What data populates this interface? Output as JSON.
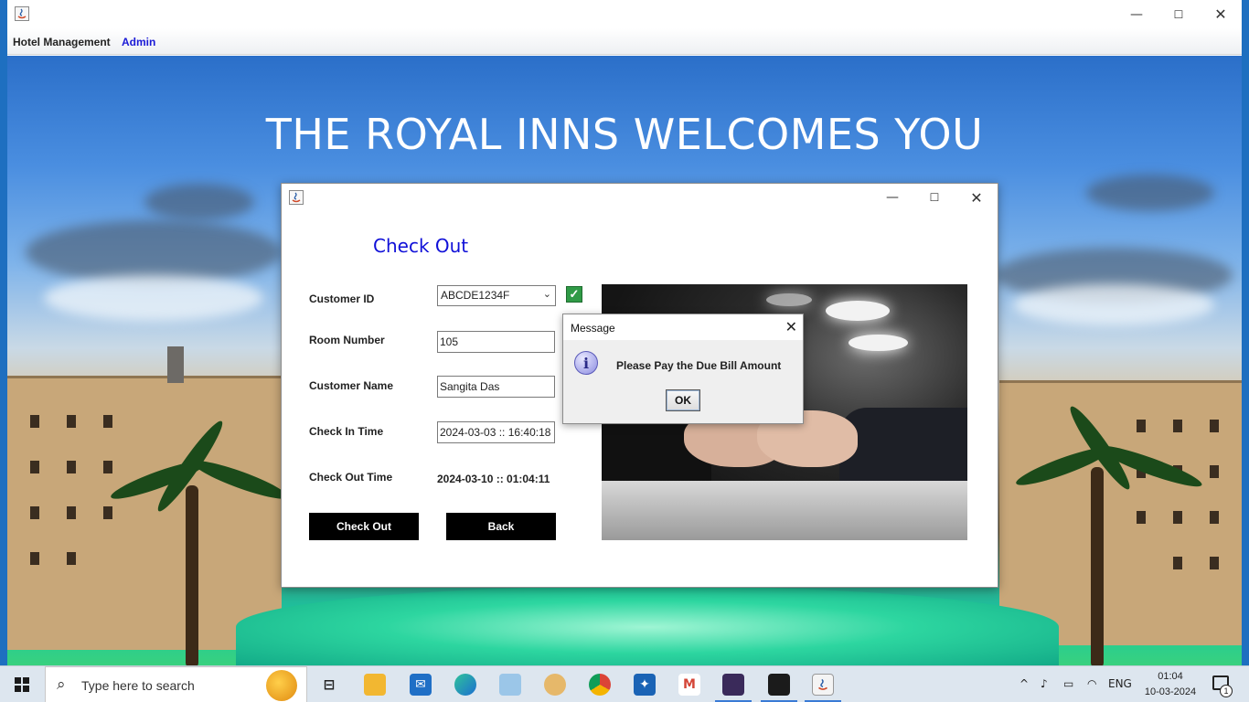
{
  "app": {
    "menu": [
      "Hotel Management",
      "Admin"
    ],
    "welcome": "THE ROYAL INNS WELCOMES YOU"
  },
  "dialog": {
    "heading": "Check Out",
    "labels": {
      "customer_id": "Customer ID",
      "room_number": "Room Number",
      "customer_name": "Customer Name",
      "check_in": "Check In Time",
      "check_out": "Check Out Time"
    },
    "values": {
      "customer_id": "ABCDE1234F",
      "room_number": "105",
      "customer_name": "Sangita Das",
      "check_in": "2024-03-03 :: 16:40:18",
      "check_out": "2024-03-10 :: 01:04:11"
    },
    "buttons": {
      "checkout": "Check Out",
      "back": "Back"
    }
  },
  "message": {
    "title": "Message",
    "text": "Please Pay the Due Bill Amount",
    "ok": "OK"
  },
  "taskbar": {
    "search_placeholder": "Type here to search",
    "tray_lang": "ENG",
    "time": "01:04",
    "date": "10-03-2024",
    "notification_count": "1"
  },
  "icons": {
    "app": "java-icon",
    "info": "info-icon",
    "check": "checkmark-icon"
  }
}
